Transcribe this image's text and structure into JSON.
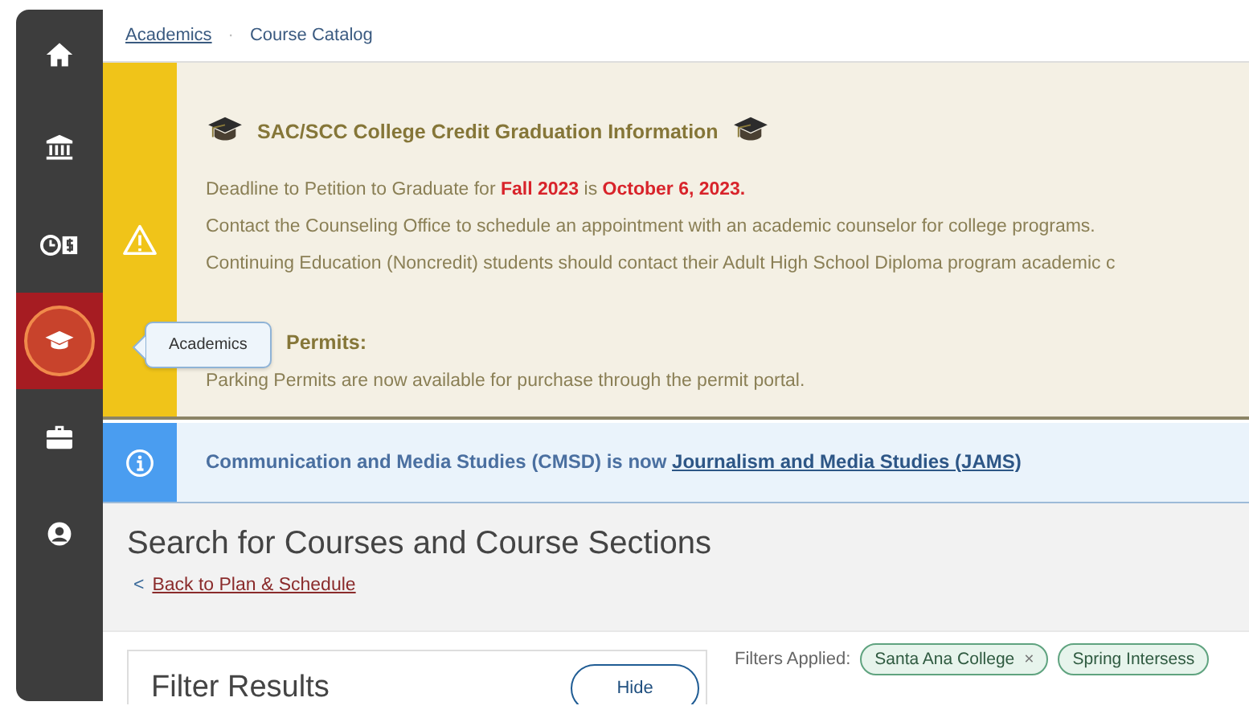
{
  "sidebar": {
    "items": [
      {
        "kind": "home",
        "selected": false
      },
      {
        "kind": "bank",
        "selected": false
      },
      {
        "kind": "finance",
        "selected": false
      },
      {
        "kind": "academics",
        "selected": true,
        "tooltip": "Academics"
      },
      {
        "kind": "briefcase",
        "selected": false
      },
      {
        "kind": "profile",
        "selected": false
      }
    ]
  },
  "breadcrumb": {
    "link": "Academics",
    "separator": "·",
    "current": "Course Catalog"
  },
  "alerts": [
    {
      "kind": "warning",
      "sections": [
        {
          "title": "SAC/SCC College Credit Graduation Information",
          "title_icons": true,
          "lines": [
            "Deadline to Petition to Graduate for **Fall 2023** is **October 6, 2023.**",
            "Contact the Counseling Office to schedule an appointment with an academic counselor for college programs.",
            "Continuing Education (Noncredit) students should contact their Adult High School Diploma program academic c"
          ]
        },
        {
          "title": "Permits:",
          "title_icons": false,
          "lines": [
            "Parking Permits are now available for purchase through the permit portal."
          ]
        }
      ]
    },
    {
      "kind": "info",
      "text": "Communication and Media Studies (CMSD) is now ",
      "link": "Journalism and Media Studies (JAMS)"
    }
  ],
  "page_header": {
    "title": "Search for Courses and Course Sections",
    "back_icon": "<",
    "back_link": "Back to Plan & Schedule"
  },
  "filters": {
    "title": "Filter Results",
    "hide_button": "Hide",
    "applied_label": "Filters Applied:",
    "chips": [
      {
        "label": "Santa Ana College",
        "remove": "×"
      },
      {
        "label": "Spring Intersess"
      }
    ]
  }
}
